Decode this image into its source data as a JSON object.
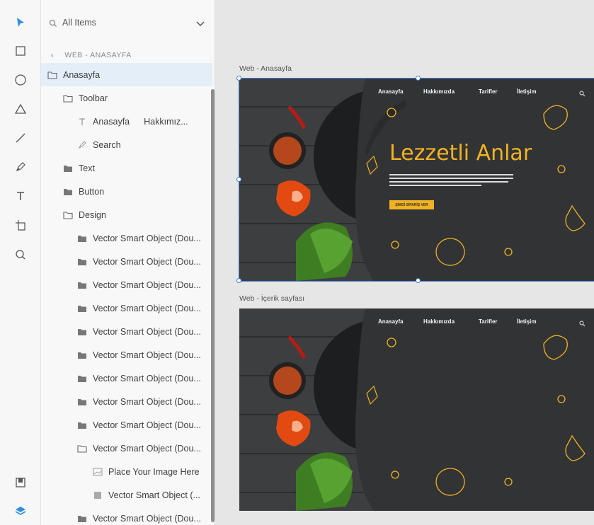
{
  "toolbar": {
    "tools": [
      "select-tool",
      "rectangle-tool",
      "ellipse-tool",
      "triangle-tool",
      "line-tool",
      "pen-tool",
      "text-tool",
      "artboard-tool",
      "zoom-tool"
    ],
    "bottom": [
      "assets-panel",
      "layers-panel"
    ]
  },
  "layers_panel": {
    "search_label": "All Items",
    "breadcrumb": "WEB - ANASAYFA",
    "rows": [
      {
        "label": "Anasayfa",
        "icon": "folder-outline-icon",
        "selected": true
      },
      {
        "label": "Toolbar",
        "icon": "folder-outline-icon"
      },
      {
        "label": "Anasayfa",
        "extra": "Hakkımız...",
        "icon": "text-layer-icon"
      },
      {
        "label": "Search",
        "icon": "pen-path-icon"
      },
      {
        "label": "Text",
        "icon": "folder-filled-icon"
      },
      {
        "label": "Button",
        "icon": "folder-filled-icon"
      },
      {
        "label": "Design",
        "icon": "folder-outline-icon"
      },
      {
        "label": "Vector Smart Object (Dou...",
        "icon": "folder-filled-icon"
      },
      {
        "label": "Vector Smart Object (Dou...",
        "icon": "folder-filled-icon"
      },
      {
        "label": "Vector Smart Object (Dou...",
        "icon": "folder-filled-icon"
      },
      {
        "label": "Vector Smart Object (Dou...",
        "icon": "folder-filled-icon"
      },
      {
        "label": "Vector Smart Object (Dou...",
        "icon": "folder-filled-icon"
      },
      {
        "label": "Vector Smart Object (Dou...",
        "icon": "folder-filled-icon"
      },
      {
        "label": "Vector Smart Object (Dou...",
        "icon": "folder-filled-icon"
      },
      {
        "label": "Vector Smart Object (Dou...",
        "icon": "folder-filled-icon"
      },
      {
        "label": "Vector Smart Object (Dou...",
        "icon": "folder-filled-icon"
      },
      {
        "label": "Vector Smart Object (Dou...",
        "icon": "folder-outline-icon"
      },
      {
        "label": "Place Your Image Here",
        "icon": "image-placeholder-icon"
      },
      {
        "label": "Vector Smart Object (...",
        "icon": "smart-object-icon"
      },
      {
        "label": "Vector Smart Object (Dou...",
        "icon": "folder-filled-icon"
      }
    ]
  },
  "canvas": {
    "artboards": [
      {
        "label": "Web - Anasayfa",
        "nav": [
          "Anasayfa",
          "Hakkımızda",
          "Tarifler",
          "İletişim"
        ],
        "title": "Lezzetli Anlar",
        "cta": "ŞİMDİ SİPARİŞ VER",
        "selected": true
      },
      {
        "label": "Web - İçerik sayfası",
        "nav": [
          "Anasayfa",
          "Hakkımızda",
          "Tarifler",
          "İletişim"
        ],
        "title": "",
        "cta": "",
        "selected": false
      }
    ]
  },
  "colors": {
    "accent": "#2f8ee0",
    "selection": "#3d7fd6",
    "hero_yellow": "#f2b322",
    "artboard_dark": "#303133",
    "wood": "#3d3e40"
  }
}
